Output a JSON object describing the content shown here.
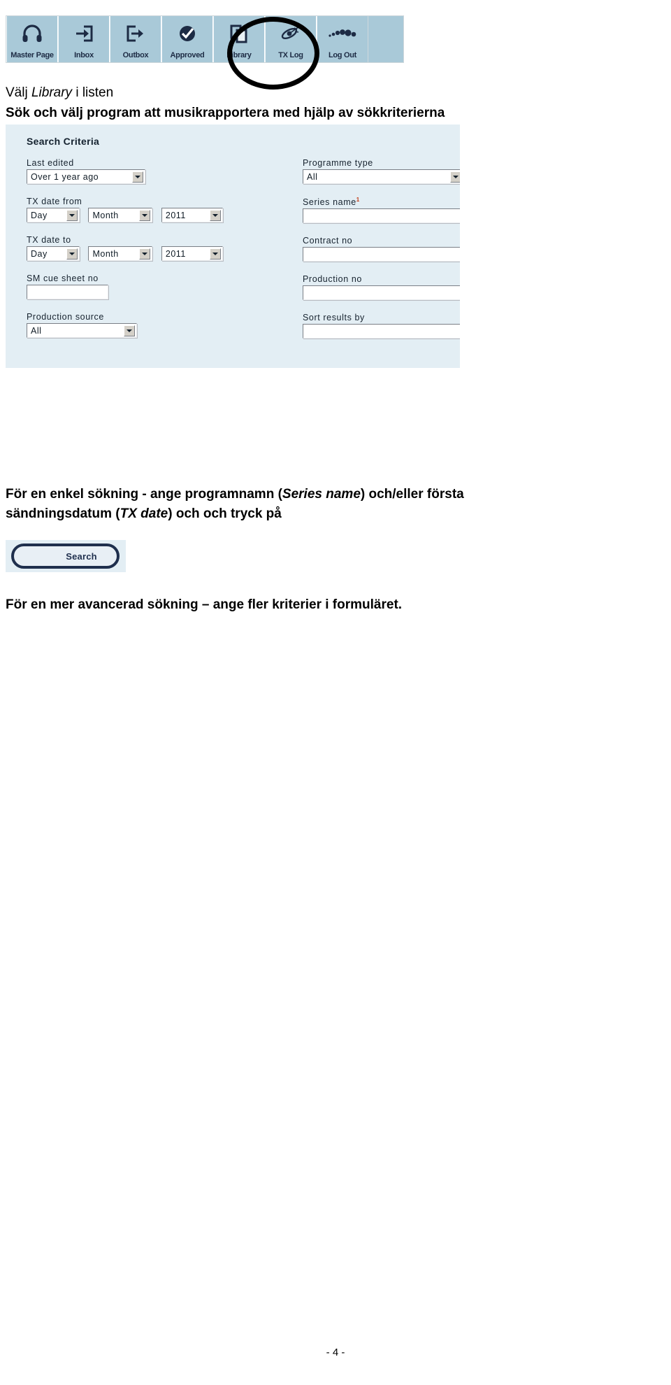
{
  "toolbar": {
    "buttons": [
      {
        "label": "Master Page",
        "icon": "headphones-icon"
      },
      {
        "label": "Inbox",
        "icon": "arrow-into-tray-icon"
      },
      {
        "label": "Outbox",
        "icon": "arrow-out-of-tray-icon"
      },
      {
        "label": "Approved",
        "icon": "check-circle-icon"
      },
      {
        "label": "Library",
        "icon": "copy-pages-icon"
      },
      {
        "label": "TX Log",
        "icon": "satellite-icon"
      },
      {
        "label": "Log Out",
        "icon": "dots-trail-icon"
      }
    ],
    "background_color": "#a9c9d8",
    "highlight_annotation": "hand-drawn-circle-around-library"
  },
  "instructions": {
    "line1_part1": "Välj ",
    "line1_italic": "Library",
    "line1_part2": " i listen",
    "line2": "Sök och välj program att musikrapportera med hjälp av sökkriterierna"
  },
  "criteria": {
    "title": "Search Criteria",
    "panel_color": "#e3eef4",
    "left_column": {
      "last_edited": {
        "label": "Last edited",
        "value": "Over 1 year ago",
        "control": "dropdown"
      },
      "tx_date_from": {
        "label": "TX date from",
        "day": "Day",
        "month": "Month",
        "year": "2011"
      },
      "tx_date_to": {
        "label": "TX date to",
        "day": "Day",
        "month": "Month",
        "year": "2011"
      },
      "sm_cue_sheet_no": {
        "label": "SM cue sheet no",
        "value": "",
        "control": "text"
      },
      "production_source": {
        "label": "Production source",
        "value": "All",
        "control": "dropdown"
      }
    },
    "right_column": {
      "programme_type": {
        "label": "Programme type",
        "value": "All",
        "control": "dropdown"
      },
      "series_name": {
        "label": "Series name",
        "superscript": "1",
        "value": "",
        "control": "text"
      },
      "contract_no": {
        "label": "Contract no",
        "value": "",
        "control": "text"
      },
      "production_no": {
        "label": "Production no",
        "value": "",
        "control": "text"
      },
      "sort_results_by": {
        "label": "Sort results by",
        "value": "",
        "control": "dropdown"
      }
    }
  },
  "paragraph": {
    "p1_a": "För en ",
    "p1_bold": "enkel",
    "p1_b": " sökning - ange programnamn (",
    "p1_italic1": "Series name",
    "p1_c": ") och/eller första",
    "p2_a": "sändningsdatum (",
    "p2_italic": "TX date",
    "p2_b": ") och och tryck på"
  },
  "search_button": {
    "label": "Search"
  },
  "final_text": {
    "a": "För en mer ",
    "bold": "avancerad sökning",
    "b": " – ange fler kriterier i formuläret."
  },
  "footer": {
    "page_number": "- 4 -"
  }
}
